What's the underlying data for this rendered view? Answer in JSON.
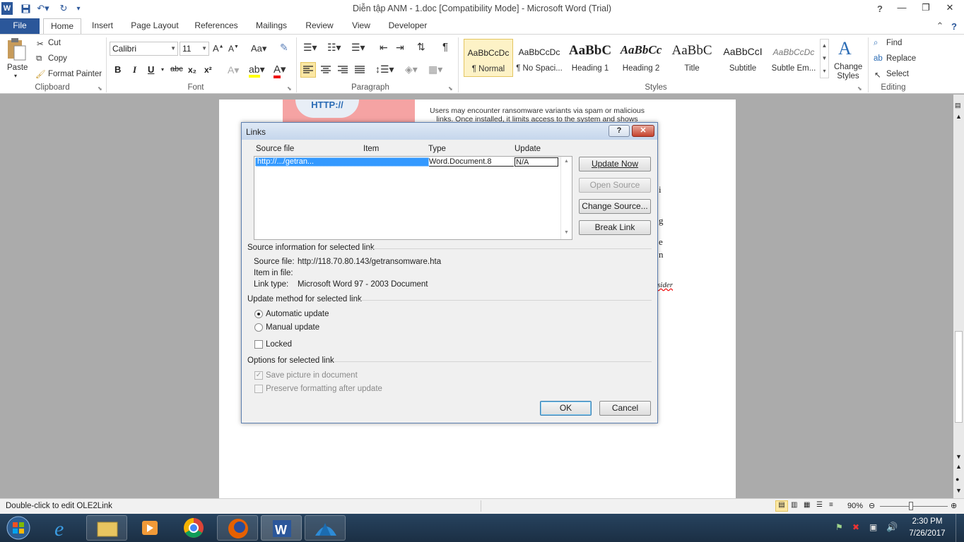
{
  "window": {
    "title": "Diễn tập ANM - 1.doc [Compatibility Mode]  -  Microsoft Word (Trial)"
  },
  "qat": {
    "word_icon": "W"
  },
  "tabs": [
    {
      "label": "File"
    },
    {
      "label": "Home"
    },
    {
      "label": "Insert"
    },
    {
      "label": "Page Layout"
    },
    {
      "label": "References"
    },
    {
      "label": "Mailings"
    },
    {
      "label": "Review"
    },
    {
      "label": "View"
    },
    {
      "label": "Developer"
    }
  ],
  "ribbon": {
    "clipboard": {
      "paste": "Paste",
      "cut": "Cut",
      "copy": "Copy",
      "format_painter": "Format Painter",
      "label": "Clipboard"
    },
    "font": {
      "family": "Calibri",
      "size": "11",
      "label": "Font",
      "bold": "B",
      "italic": "I",
      "underline": "U",
      "strike": "abc",
      "sub": "x₂",
      "sup": "x²"
    },
    "paragraph": {
      "label": "Paragraph",
      "pilcrow": "¶"
    },
    "styles": {
      "label": "Styles",
      "items": [
        {
          "preview": "AaBbCcDc",
          "name": "¶ Normal"
        },
        {
          "preview": "AaBbCcDc",
          "name": "¶ No Spaci..."
        },
        {
          "preview": "AaBbC",
          "name": "Heading 1"
        },
        {
          "preview": "AaBbCc",
          "name": "Heading 2"
        },
        {
          "preview": "AaBbC",
          "name": "Title"
        },
        {
          "preview": "AaBbCcI",
          "name": "Subtitle"
        },
        {
          "preview": "AaBbCcDc",
          "name": "Subtle Em..."
        }
      ],
      "change_styles": "Change Styles"
    },
    "editing": {
      "find": "Find",
      "replace": "Replace",
      "select": "Select",
      "label": "Editing"
    }
  },
  "document": {
    "banner_text_1": "Users may encounter ransomware variants via spam or malicious",
    "banner_text_2": "links. Once installed, it limits access to the system and shows",
    "banner_badge": "HTTP://",
    "fragments": [
      "i",
      "g",
      "e",
      "n",
      "sider"
    ]
  },
  "dialog": {
    "title": "Links",
    "help": "?",
    "columns": [
      "Source file",
      "Item",
      "Type",
      "Update"
    ],
    "rows": [
      {
        "source": "http://.../getran...",
        "item": "",
        "type": "Word.Document.8",
        "update": "N/A"
      }
    ],
    "buttons": {
      "update_now": "Update Now",
      "open_source": "Open Source",
      "change_source": "Change Source...",
      "break_link": "Break Link",
      "ok": "OK",
      "cancel": "Cancel"
    },
    "source_info": {
      "heading": "Source information for selected link",
      "source_file_label": "Source file:",
      "source_file_value": "http://118.70.80.143/getransomware.hta",
      "item_label": "Item in file:",
      "item_value": "",
      "link_type_label": "Link type:",
      "link_type_value": "Microsoft Word 97 - 2003 Document"
    },
    "update_method": {
      "heading": "Update method for selected link",
      "automatic": "Automatic update",
      "manual": "Manual update",
      "locked": "Locked",
      "selected": "automatic"
    },
    "options": {
      "heading": "Options for selected link",
      "save_picture": "Save picture in document",
      "preserve_formatting": "Preserve formatting after update"
    }
  },
  "statusbar": {
    "message": "Double-click to edit OLE2Link",
    "zoom": "90%"
  },
  "taskbar": {
    "time": "2:30 PM",
    "date": "7/26/2017",
    "apps": [
      "internet-explorer",
      "file-explorer",
      "media-player",
      "chrome",
      "firefox",
      "word",
      "wireshark"
    ]
  },
  "colors": {
    "file_tab": "#2b579a",
    "selection": "#3399ff",
    "taskbar": "#1f3550"
  }
}
